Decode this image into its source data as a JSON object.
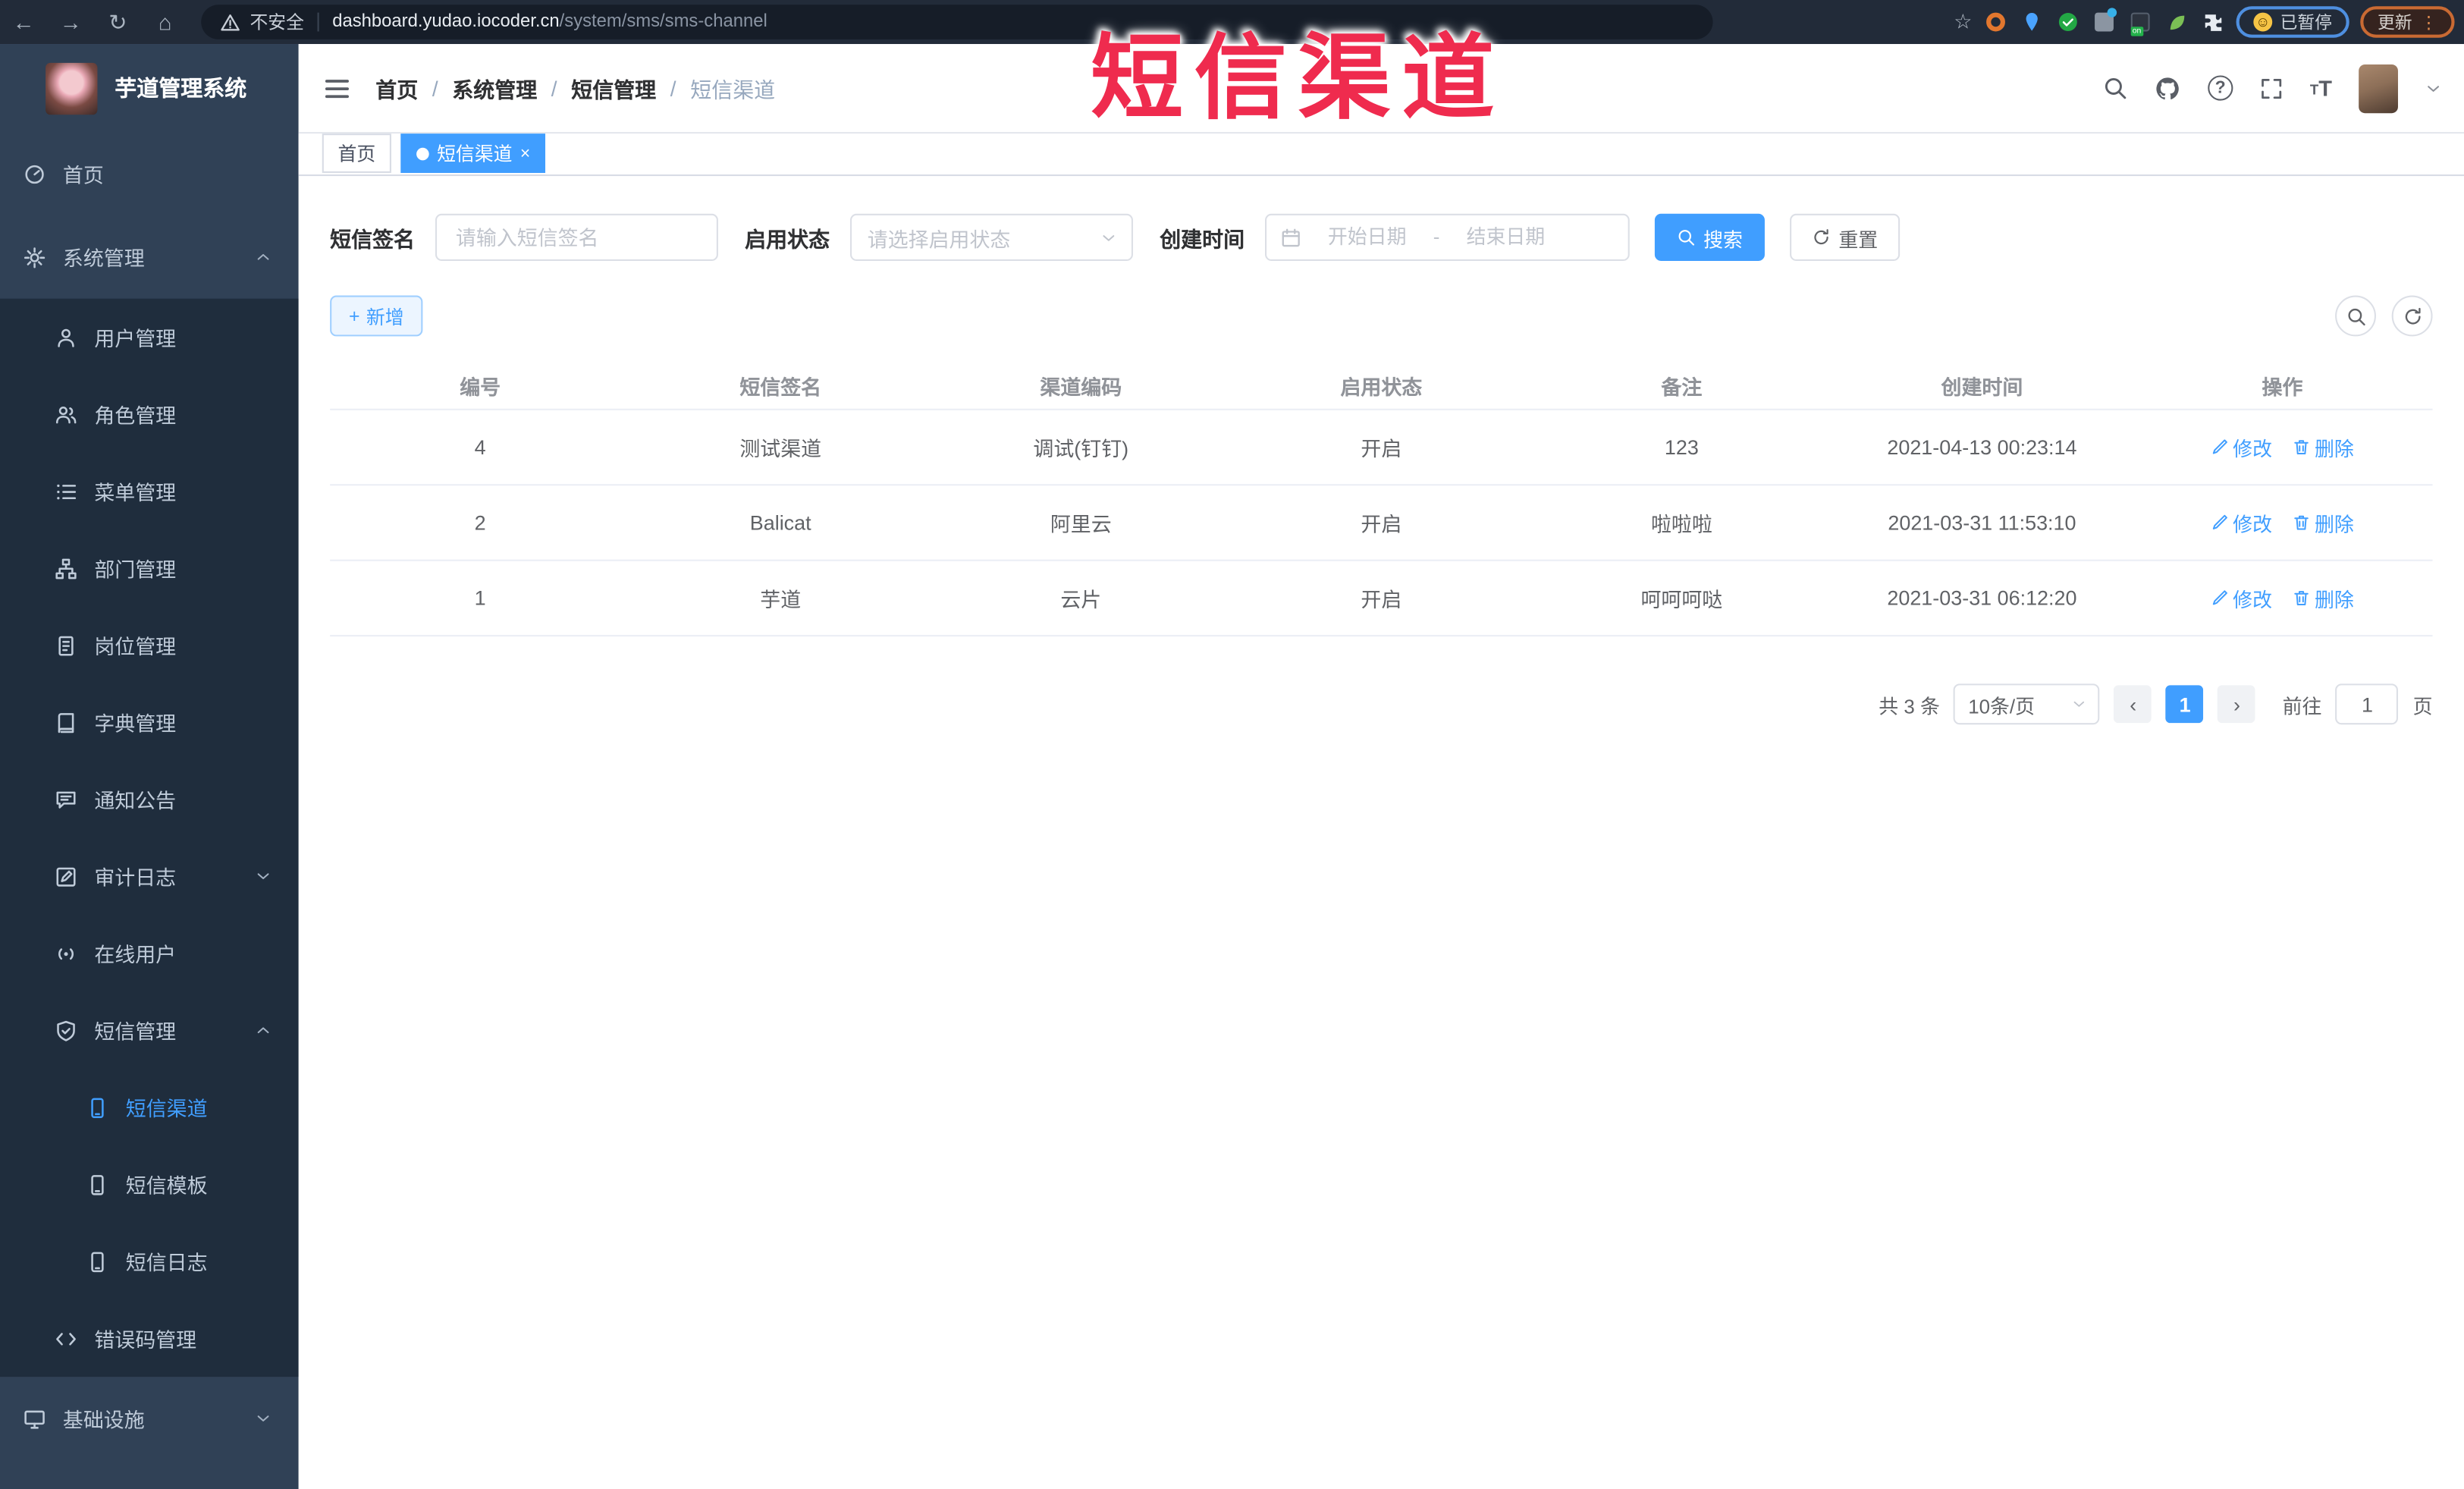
{
  "browser": {
    "security_label": "不安全",
    "url_host": "dashboard.yudao.iocoder.cn",
    "url_path": "/system/sms/sms-channel",
    "paused_badge": "已暂停",
    "update_button": "更新"
  },
  "watermark": {
    "text": "短信渠道",
    "color": "#ef2b4e"
  },
  "sidebar": {
    "logo_title": "芋道管理系统",
    "items": [
      {
        "label": "首页"
      },
      {
        "label": "系统管理"
      },
      {
        "label": "用户管理"
      },
      {
        "label": "角色管理"
      },
      {
        "label": "菜单管理"
      },
      {
        "label": "部门管理"
      },
      {
        "label": "岗位管理"
      },
      {
        "label": "字典管理"
      },
      {
        "label": "通知公告"
      },
      {
        "label": "审计日志"
      },
      {
        "label": "在线用户"
      },
      {
        "label": "短信管理"
      },
      {
        "label": "短信渠道"
      },
      {
        "label": "短信模板"
      },
      {
        "label": "短信日志"
      },
      {
        "label": "错误码管理"
      },
      {
        "label": "基础设施"
      }
    ]
  },
  "header": {
    "breadcrumb": [
      "首页",
      "系统管理",
      "短信管理",
      "短信渠道"
    ]
  },
  "tabs": [
    {
      "label": "首页"
    },
    {
      "label": "短信渠道"
    }
  ],
  "filters": {
    "sign_label": "短信签名",
    "sign_placeholder": "请输入短信签名",
    "status_label": "启用状态",
    "status_placeholder": "请选择启用状态",
    "date_label": "创建时间",
    "date_start_placeholder": "开始日期",
    "date_separator": "-",
    "date_end_placeholder": "结束日期",
    "search_button": "搜索",
    "reset_button": "重置"
  },
  "toolbar": {
    "add_button": "新增"
  },
  "table": {
    "columns": [
      "编号",
      "短信签名",
      "渠道编码",
      "启用状态",
      "备注",
      "创建时间",
      "操作"
    ],
    "rows": [
      {
        "id": "4",
        "sign": "测试渠道",
        "code": "调试(钉钉)",
        "status": "开启",
        "remark": "123",
        "created": "2021-04-13 00:23:14"
      },
      {
        "id": "2",
        "sign": "Balicat",
        "code": "阿里云",
        "status": "开启",
        "remark": "啦啦啦",
        "created": "2021-03-31 11:53:10"
      },
      {
        "id": "1",
        "sign": "芋道",
        "code": "云片",
        "status": "开启",
        "remark": "呵呵呵哒",
        "created": "2021-03-31 06:12:20"
      }
    ],
    "actions": {
      "edit": "修改",
      "delete": "删除"
    }
  },
  "pagination": {
    "total": "共 3 条",
    "page_size": "10条/页",
    "current_page": "1",
    "goto_label": "前往",
    "goto_value": "1",
    "page_unit": "页"
  },
  "icons": {
    "back": "←",
    "forward": "→",
    "reload": "↻",
    "home": "⌂",
    "star": "☆",
    "more_menu": "⋮",
    "smiley": "☺",
    "tab_close": "×",
    "add_plus": "+",
    "breadcrumb_separator": "/",
    "prev_page": "‹",
    "next_page": "›",
    "font_size_glyph": "T",
    "ext_on_badge": "on"
  },
  "colors": {
    "accent": "#409eff",
    "watermark": "#ef2b4e",
    "sidebar_bg": "#304156",
    "submenu_bg": "#1f2d3d",
    "browser_bar": "#222b39"
  }
}
